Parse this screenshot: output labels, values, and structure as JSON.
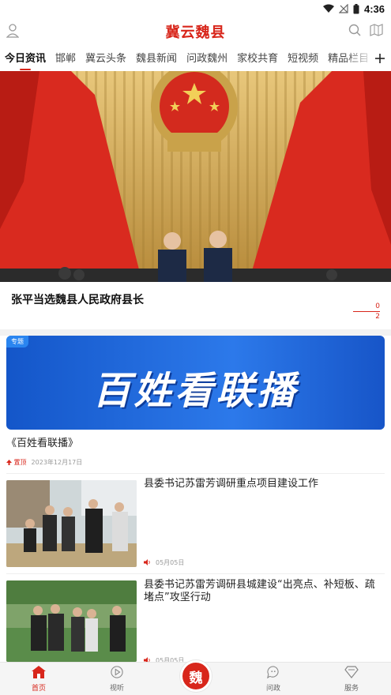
{
  "status": {
    "time": "4:36"
  },
  "header": {
    "title": "冀云魏县"
  },
  "tabs": [
    "今日资讯",
    "邯郸",
    "冀云头条",
    "魏县新闻",
    "问政魏州",
    "家校共育",
    "短视频",
    "精品栏目"
  ],
  "hero": {
    "title": "张平当选魏县人民政府县长",
    "page_current": "0",
    "page_total": "2"
  },
  "special": {
    "tag": "专题",
    "banner_text": "百姓看联播",
    "title": "《百姓看联播》",
    "sticky": "置顶",
    "date": "2023年12月17日"
  },
  "news": [
    {
      "title": "县委书记苏雷芳调研重点项目建设工作",
      "date": "05月05日"
    },
    {
      "title": "县委书记苏雷芳调研县城建设“出亮点、补短板、疏堵点”攻坚行动",
      "date": "05月05日"
    }
  ],
  "bottom_nav": {
    "home": "首页",
    "listen": "视听",
    "center": "魏",
    "ask": "问政",
    "service": "服务"
  },
  "colors": {
    "brand": "#d8261b",
    "banner": "#1f6be0"
  }
}
